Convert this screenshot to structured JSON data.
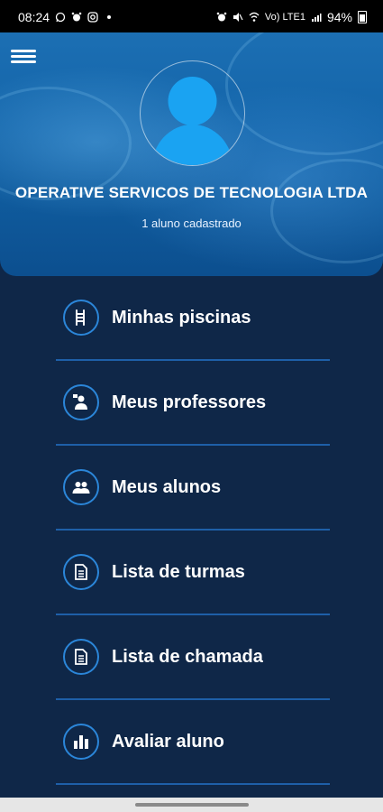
{
  "status_bar": {
    "time": "08:24",
    "battery_percent": "94%",
    "signal_text": "Vo) LTE1"
  },
  "header": {
    "company_name": "OPERATIVE SERVICOS DE TECNOLOGIA LTDA",
    "subtitle": "1 aluno cadastrado"
  },
  "menu": {
    "items": [
      {
        "label": "Minhas piscinas",
        "icon": "pool-ladder-icon"
      },
      {
        "label": "Meus professores",
        "icon": "teacher-icon"
      },
      {
        "label": "Meus alunos",
        "icon": "students-icon"
      },
      {
        "label": "Lista de turmas",
        "icon": "document-icon"
      },
      {
        "label": "Lista de chamada",
        "icon": "document-icon"
      },
      {
        "label": "Avaliar aluno",
        "icon": "chart-bars-icon"
      }
    ]
  },
  "colors": {
    "background": "#0f2748",
    "accent": "#2b86d9",
    "divider": "#1e5fa8",
    "avatar": "#1aa3f2"
  }
}
